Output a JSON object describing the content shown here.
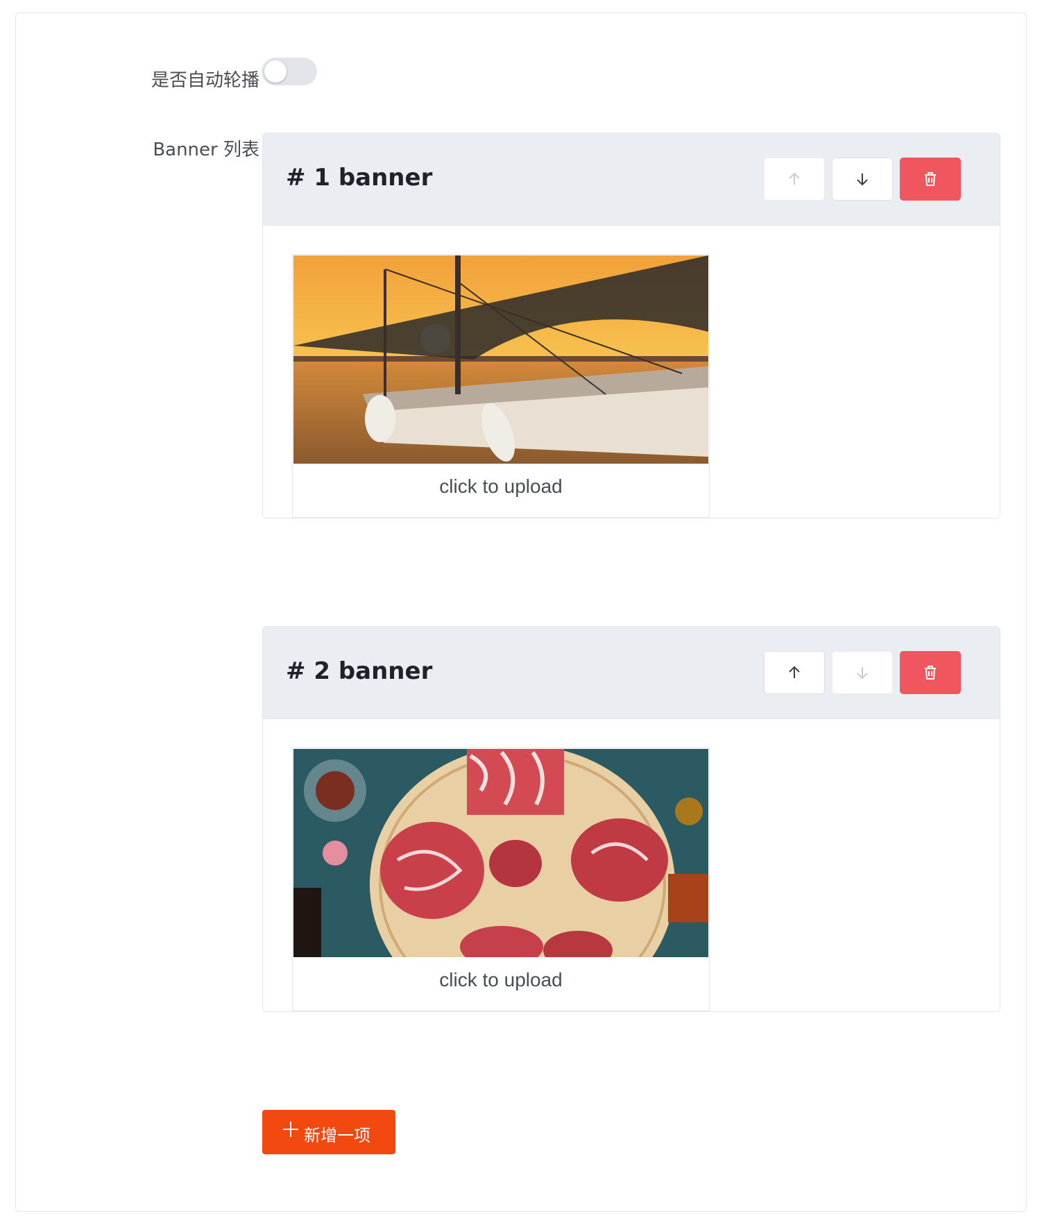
{
  "form": {
    "autoplay_label": "是否自动轮播",
    "autoplay_enabled": false,
    "list_label": "Banner 列表"
  },
  "banners": [
    {
      "title": "# 1 banner",
      "upload_text": "click to upload",
      "image_alt": "sailboat at sunset",
      "up_disabled": true,
      "down_disabled": false
    },
    {
      "title": "# 2 banner",
      "upload_text": "click to upload",
      "image_alt": "raw steaks on wooden board",
      "up_disabled": false,
      "down_disabled": true
    }
  ],
  "add_button": {
    "label": "新增一项",
    "icon": "plus-icon"
  },
  "colors": {
    "danger": "#f0565d",
    "primary": "#f1490f",
    "panel_header": "#eaedf1"
  }
}
